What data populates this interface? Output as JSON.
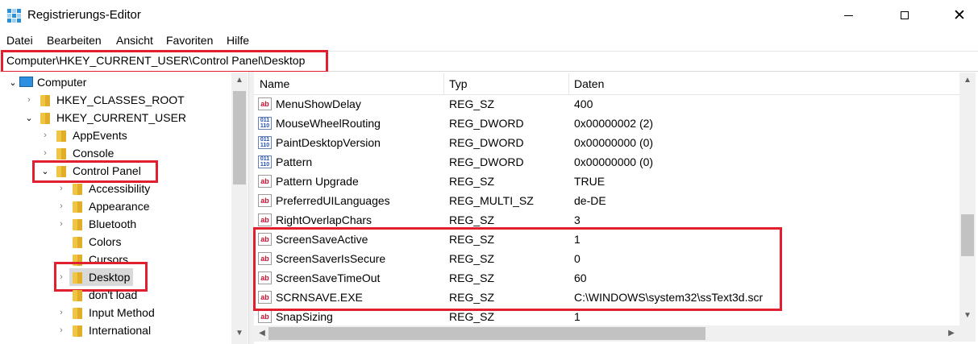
{
  "window": {
    "title": "Registrierungs-Editor",
    "minimize_glyph": "",
    "close_glyph": "✕"
  },
  "menu": [
    "Datei",
    "Bearbeiten",
    "Ansicht",
    "Favoriten",
    "Hilfe"
  ],
  "address": {
    "path": "Computer\\HKEY_CURRENT_USER\\Control Panel\\Desktop"
  },
  "tree": {
    "items": [
      {
        "label": "Computer",
        "expanded": true
      },
      {
        "label": "HKEY_CLASSES_ROOT",
        "expanded": false
      },
      {
        "label": "HKEY_CURRENT_USER",
        "expanded": true
      },
      {
        "label": "AppEvents",
        "expanded": false
      },
      {
        "label": "Console",
        "expanded": false
      },
      {
        "label": "Control Panel",
        "expanded": true
      },
      {
        "label": "Accessibility",
        "expanded": false
      },
      {
        "label": "Appearance",
        "expanded": false
      },
      {
        "label": "Bluetooth",
        "expanded": false
      },
      {
        "label": "Colors",
        "expanded": false
      },
      {
        "label": "Cursors",
        "expanded": false
      },
      {
        "label": "Desktop",
        "expanded": false,
        "selected": true
      },
      {
        "label": "don't load",
        "expanded": false
      },
      {
        "label": "Input Method",
        "expanded": false
      },
      {
        "label": "International",
        "expanded": false
      }
    ]
  },
  "list": {
    "columns": [
      "Name",
      "Typ",
      "Daten"
    ],
    "rows": [
      {
        "name": "MenuShowDelay",
        "type": "REG_SZ",
        "data": "400",
        "icon": "string-value-icon"
      },
      {
        "name": "MouseWheelRouting",
        "type": "REG_DWORD",
        "data": "0x00000002 (2)",
        "icon": "binary-value-icon"
      },
      {
        "name": "PaintDesktopVersion",
        "type": "REG_DWORD",
        "data": "0x00000000 (0)",
        "icon": "binary-value-icon"
      },
      {
        "name": "Pattern",
        "type": "REG_DWORD",
        "data": "0x00000000 (0)",
        "icon": "binary-value-icon"
      },
      {
        "name": "Pattern Upgrade",
        "type": "REG_SZ",
        "data": "TRUE",
        "icon": "string-value-icon"
      },
      {
        "name": "PreferredUILanguages",
        "type": "REG_MULTI_SZ",
        "data": "de-DE",
        "icon": "string-value-icon"
      },
      {
        "name": "RightOverlapChars",
        "type": "REG_SZ",
        "data": "3",
        "icon": "string-value-icon"
      },
      {
        "name": "ScreenSaveActive",
        "type": "REG_SZ",
        "data": "1",
        "icon": "string-value-icon"
      },
      {
        "name": "ScreenSaverIsSecure",
        "type": "REG_SZ",
        "data": "0",
        "icon": "string-value-icon"
      },
      {
        "name": "ScreenSaveTimeOut",
        "type": "REG_SZ",
        "data": "60",
        "icon": "string-value-icon"
      },
      {
        "name": "SCRNSAVE.EXE",
        "type": "REG_SZ",
        "data": "C:\\WINDOWS\\system32\\ssText3d.scr",
        "icon": "string-value-icon"
      },
      {
        "name": "SnapSizing",
        "type": "REG_SZ",
        "data": "1",
        "icon": "string-value-icon"
      }
    ]
  },
  "colors": {
    "highlight": "#e0202e"
  }
}
